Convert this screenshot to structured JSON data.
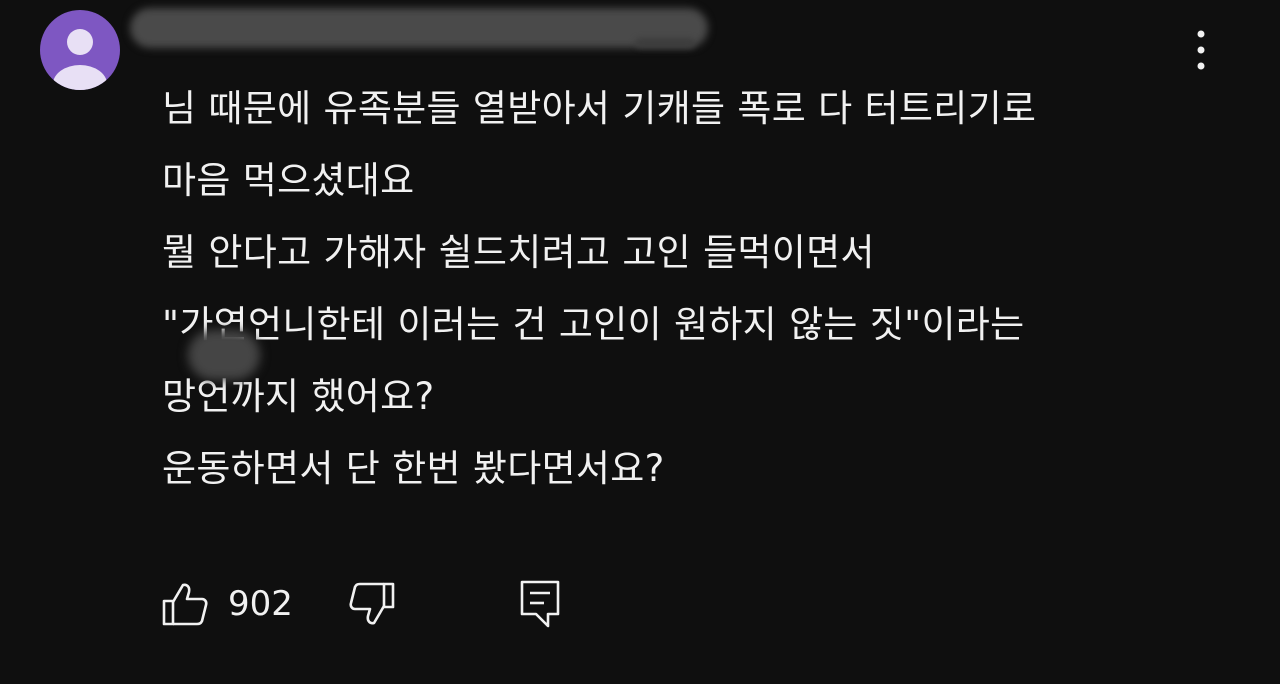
{
  "comment": {
    "author_avatar_color": "#7e57c2",
    "lines": [
      "님 때문에 유족분들 열받아서 기캐들 폭로 다 터트리기로",
      "마음 먹으셨대요",
      "뭘 안다고 가해자 쉴드치려고 고인 들먹이면서",
      "\"가연언니한테 이러는 건 고인이 원하지 않는 짓\"이라는",
      "망언까지 했어요?",
      "운동하면서 단 한번 봤다면서요?"
    ]
  },
  "actions": {
    "like_count": "902",
    "like_icon": "thumbs-up-icon",
    "dislike_icon": "thumbs-down-icon",
    "reply_icon": "comment-reply-icon",
    "menu_icon": "more-vertical-icon"
  }
}
